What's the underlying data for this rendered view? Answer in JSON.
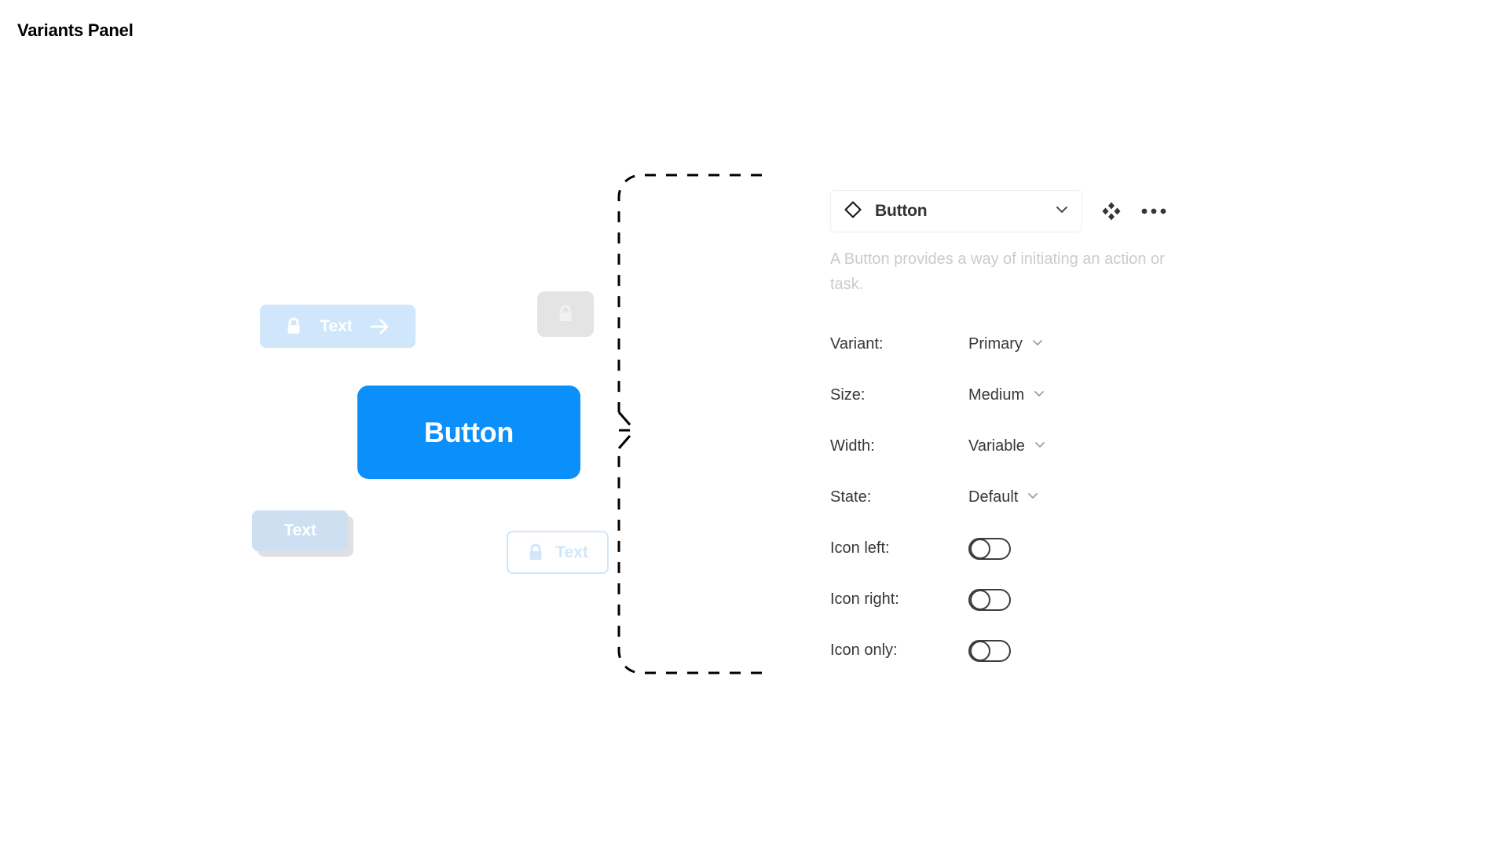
{
  "page": {
    "title": "Variants Panel"
  },
  "canvas": {
    "buttons": [
      {
        "id": "lightblue-full",
        "label": "Text",
        "icon_left": "lock-icon",
        "icon_right": "arrow-right-icon",
        "fill": "#cfe6fb",
        "text_color": "#ffffff"
      },
      {
        "id": "gray-icon-only",
        "label": "",
        "icon_left": "lock-icon",
        "fill": "#e4e4e4",
        "icon_color": "#f2f2f2"
      },
      {
        "id": "primary",
        "label": "Button",
        "fill": "#0a8ffb",
        "text_color": "#ffffff"
      },
      {
        "id": "lightblue-shadow",
        "label": "Text",
        "fill": "#cddff0",
        "text_color": "#ffffff"
      },
      {
        "id": "outline",
        "label": "Text",
        "icon_left": "lock-icon",
        "fill": "#ffffff",
        "border_color": "#cfe6fb",
        "text_color": "#cfe6fb"
      }
    ]
  },
  "inspector": {
    "component": {
      "icon": "diamond-component-icon",
      "name": "Button",
      "chevron": "chevron-down-icon"
    },
    "header_actions": [
      {
        "icon": "variants-diamonds-icon",
        "name": "variants"
      },
      {
        "icon": "ellipsis-horizontal-icon",
        "name": "more-options"
      }
    ],
    "description": "A Button provides a way of initiating an action or task.",
    "properties": [
      {
        "label": "Variant:",
        "type": "select",
        "value": "Primary"
      },
      {
        "label": "Size:",
        "type": "select",
        "value": "Medium"
      },
      {
        "label": "Width:",
        "type": "select",
        "value": "Variable"
      },
      {
        "label": "State:",
        "type": "select",
        "value": "Default"
      },
      {
        "label": "Icon left:",
        "type": "toggle",
        "value": "off"
      },
      {
        "label": "Icon right:",
        "type": "toggle",
        "value": "off"
      },
      {
        "label": "Icon only:",
        "type": "toggle",
        "value": "off"
      }
    ]
  },
  "colors": {
    "accent": "#0a8ffb",
    "light_blue": "#cfe6fb",
    "muted_text": "#c9cbcd",
    "label_text": "#35383b"
  }
}
